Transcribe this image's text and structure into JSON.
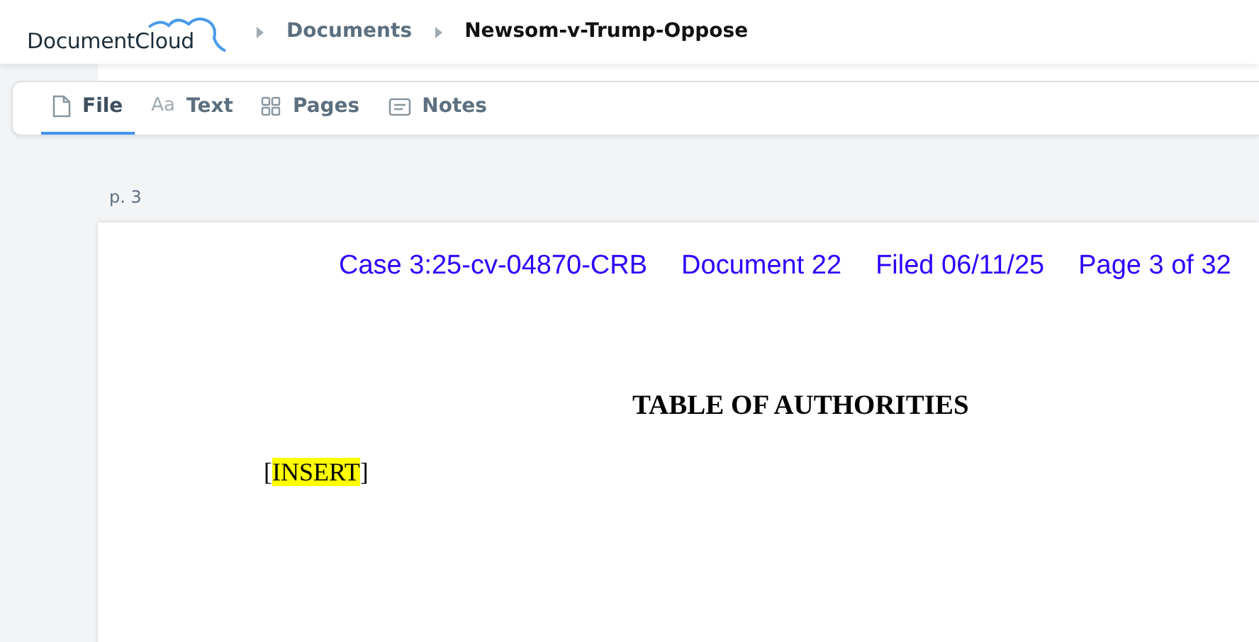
{
  "brand": {
    "name": "DocumentCloud"
  },
  "breadcrumbs": [
    {
      "label": "Documents",
      "current": false
    },
    {
      "label": "Newsom-v-Trump-Oppose",
      "current": true
    }
  ],
  "tabs": [
    {
      "label": "File",
      "kind": "file",
      "selected": true
    },
    {
      "label": "Text",
      "kind": "glyph",
      "glyph": "Aa",
      "selected": false
    },
    {
      "label": "Pages",
      "kind": "grid",
      "selected": false
    },
    {
      "label": "Notes",
      "kind": "note",
      "selected": false
    }
  ],
  "page": {
    "label": "p. 3",
    "header": [
      "Case 3:25-cv-04870-CRB",
      "Document 22",
      "Filed 06/11/25",
      "Page 3 of 32"
    ],
    "title": "TABLE OF AUTHORITIES",
    "body": {
      "before": "[",
      "highlight": "INSERT",
      "after": "]"
    }
  }
}
